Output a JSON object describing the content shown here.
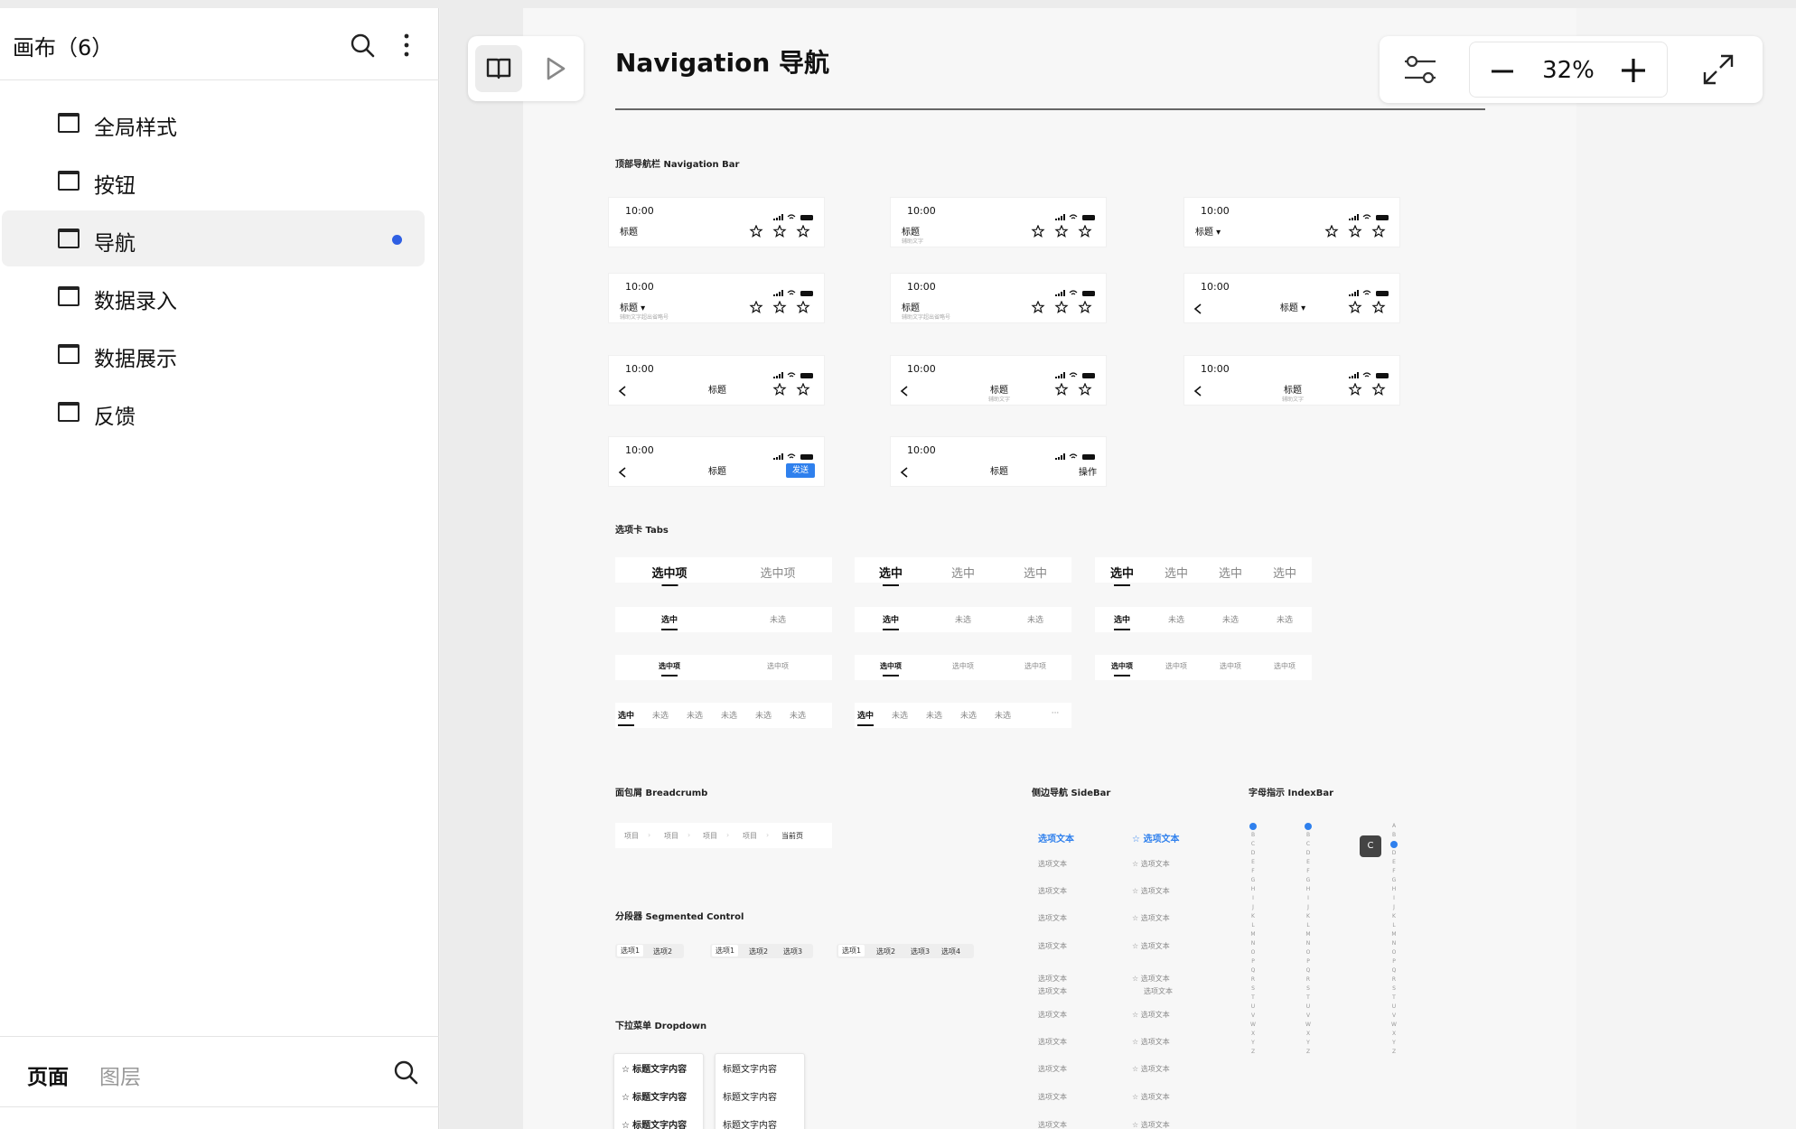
{
  "sidebar": {
    "title": "画布（6）",
    "pages": [
      "全局样式",
      "按钮",
      "导航",
      "数据录入",
      "数据展示",
      "反馈"
    ],
    "active_index": 2,
    "footer": {
      "tab_pages": "页面",
      "tab_layers": "图层"
    }
  },
  "toolbar": {
    "zoom": "32%"
  },
  "canvas": {
    "title": "Navigation 导航",
    "sections": {
      "navbar": "顶部导航栏 Navigation Bar",
      "tabs": "选项卡 Tabs",
      "breadcrumb": "面包屑 Breadcrumb",
      "sidebar": "侧边导航 SideBar",
      "indexbar": "字母指示 IndexBar",
      "segmented": "分段器 Segmented Control",
      "dropdown": "下拉菜单 Dropdown"
    },
    "navbars": {
      "time": "10:00",
      "title": "标题",
      "title_dropdown": "标题 ▾",
      "subtitle": "辅助文字",
      "subtitle_long": "辅助文字超出省略号",
      "send": "发送",
      "action": "操作"
    },
    "tabs": {
      "selected_item": "选中项",
      "selected": "选中",
      "unselected": "未选",
      "more": "···"
    },
    "breadcrumb": {
      "items": [
        "项目",
        "项目",
        "项目",
        "项目"
      ],
      "current": "当前页"
    },
    "segmented": {
      "options": [
        "选项1",
        "选项2",
        "选项3",
        "选项4"
      ]
    },
    "side_nav": {
      "item": "选项文本",
      "double_line": "选项文本"
    },
    "indexbar": {
      "letters": [
        "A",
        "B",
        "C",
        "D",
        "E",
        "F",
        "G",
        "H",
        "I",
        "J",
        "K",
        "L",
        "M",
        "N",
        "O",
        "P",
        "Q",
        "R",
        "S",
        "T",
        "U",
        "V",
        "W",
        "X",
        "Y",
        "Z"
      ],
      "bubble": "C"
    },
    "dropdown": {
      "item": "标题文字内容"
    }
  }
}
